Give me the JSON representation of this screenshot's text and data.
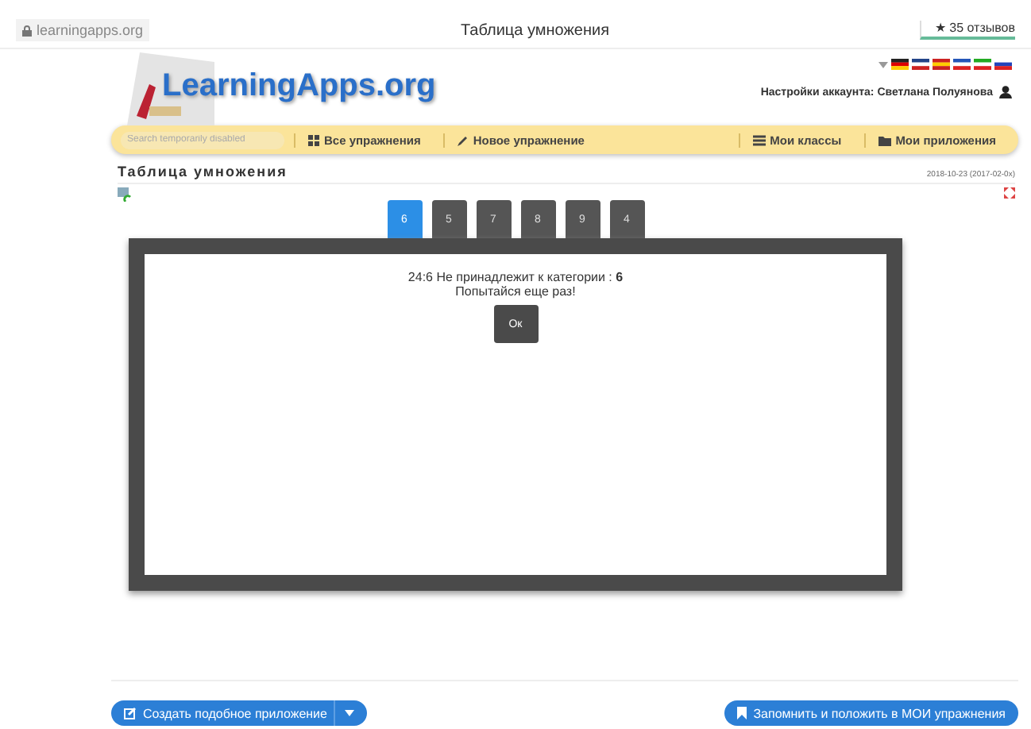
{
  "browser": {
    "address": "learningapps.org",
    "title": "Таблица умножения",
    "reviews": "★ 35 отзывов"
  },
  "header": {
    "logo": "LearningApps.org",
    "account": "Настройки аккаунта: Светлана Полуянова"
  },
  "nav": {
    "search": {
      "placeholder": "Search temporarily disabled"
    },
    "items": [
      {
        "label": "Все упражнения"
      },
      {
        "label": "Новое упражнение"
      },
      {
        "label": "Мои классы"
      },
      {
        "label": "Мои приложения"
      }
    ]
  },
  "app": {
    "title": "Таблица умножения",
    "date": "2018-10-23 (2017-02-0x)",
    "tabs": [
      {
        "label": "6",
        "selected": true
      },
      {
        "label": "5",
        "selected": false
      },
      {
        "label": "7",
        "selected": false
      },
      {
        "label": "8",
        "selected": false
      },
      {
        "label": "9",
        "selected": false
      },
      {
        "label": "4",
        "selected": false
      }
    ],
    "dialog": {
      "message": "24:6 Не принадлежит к категории : **6**",
      "hint": "Попытайся еще раз!",
      "button": "Ок"
    }
  },
  "footer": {
    "create": "Создать подобное приложение",
    "save": "Запомнить и положить в МОИ упражнения"
  }
}
